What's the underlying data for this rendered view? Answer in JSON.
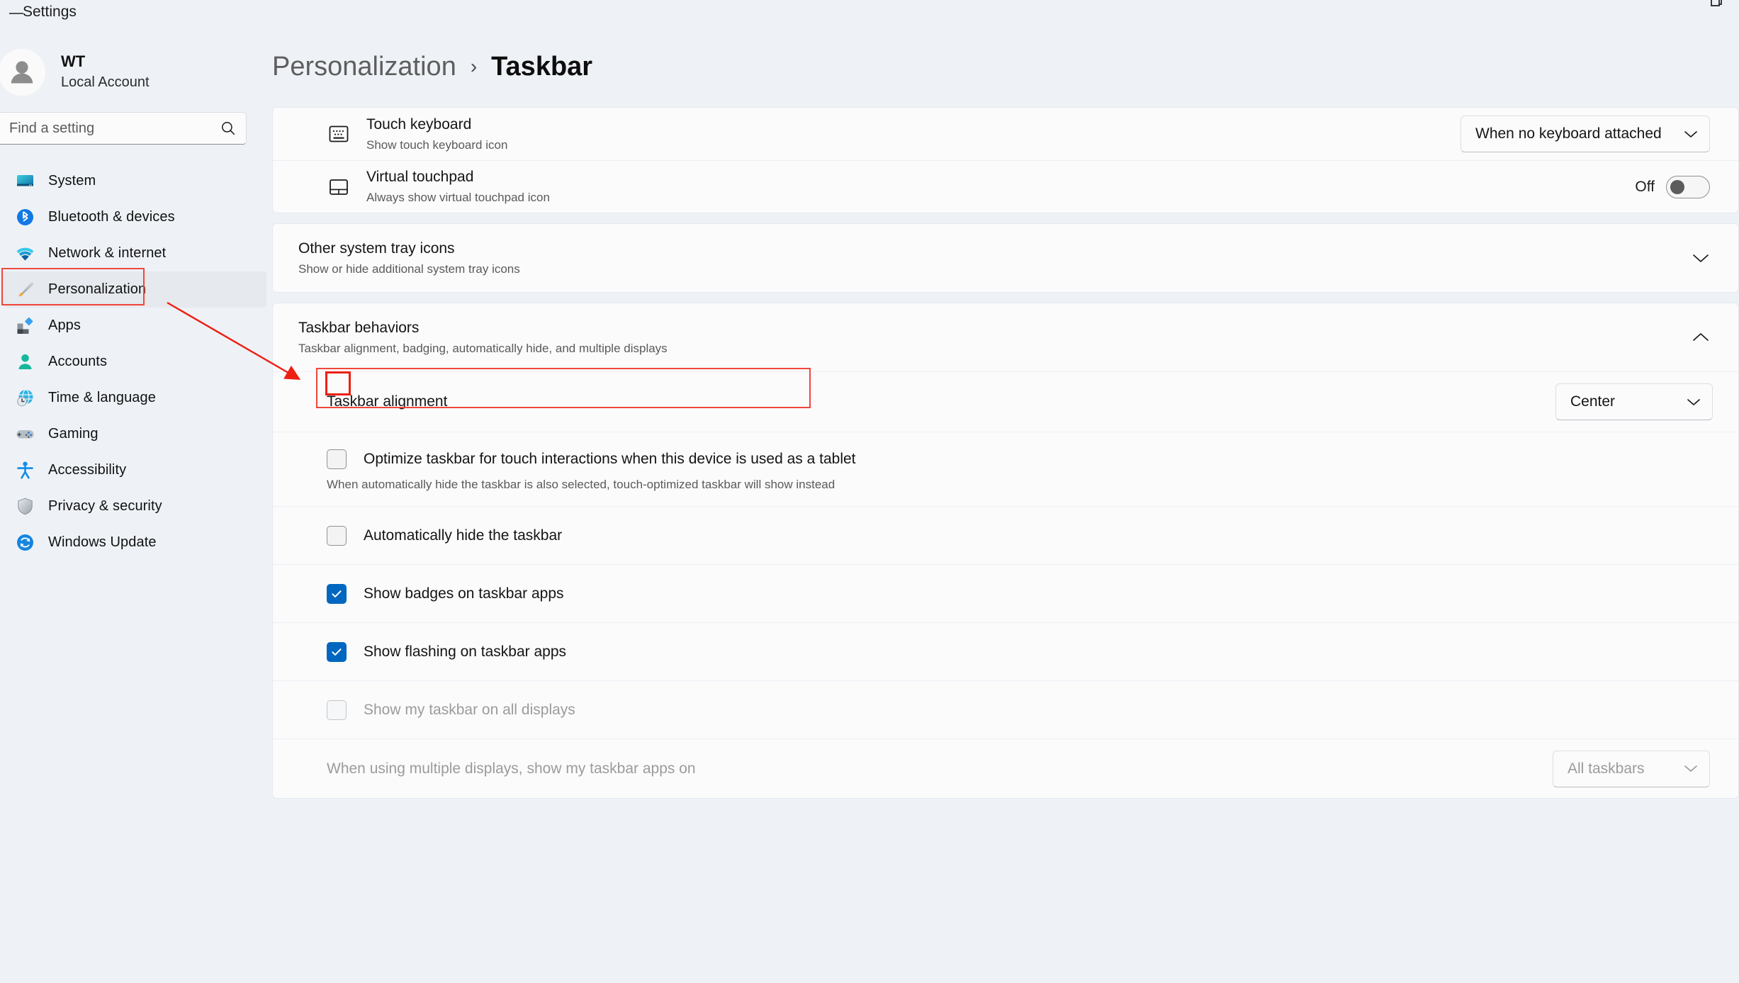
{
  "window": {
    "title": "Settings",
    "back_icon": "back-arrow-icon",
    "restore_icon": "restore-window-icon"
  },
  "sidebar": {
    "account": {
      "name": "WT",
      "type": "Local Account",
      "avatar_icon": "user-avatar-icon"
    },
    "search": {
      "placeholder": "Find a setting",
      "icon": "search-icon",
      "value": ""
    },
    "items": [
      {
        "label": "System",
        "icon": "monitor-icon",
        "active": false
      },
      {
        "label": "Bluetooth & devices",
        "icon": "bluetooth-icon",
        "active": false
      },
      {
        "label": "Network & internet",
        "icon": "wifi-icon",
        "active": false
      },
      {
        "label": "Personalization",
        "icon": "paintbrush-icon",
        "active": true
      },
      {
        "label": "Apps",
        "icon": "apps-icon",
        "active": false
      },
      {
        "label": "Accounts",
        "icon": "person-icon",
        "active": false
      },
      {
        "label": "Time & language",
        "icon": "globe-clock-icon",
        "active": false
      },
      {
        "label": "Gaming",
        "icon": "gamepad-icon",
        "active": false
      },
      {
        "label": "Accessibility",
        "icon": "accessibility-icon",
        "active": false
      },
      {
        "label": "Privacy & security",
        "icon": "shield-icon",
        "active": false
      },
      {
        "label": "Windows Update",
        "icon": "update-refresh-icon",
        "active": false
      }
    ]
  },
  "breadcrumb": {
    "parent": "Personalization",
    "separator": "›",
    "current": "Taskbar"
  },
  "main": {
    "touch_keyboard": {
      "title": "Touch keyboard",
      "subtitle": "Show touch keyboard icon",
      "icon": "touch-keyboard-icon",
      "dropdown_value": "When no keyboard attached",
      "chevron": "chevron-down-icon"
    },
    "virtual_touchpad": {
      "title": "Virtual touchpad",
      "subtitle": "Always show virtual touchpad icon",
      "icon": "touchpad-icon",
      "toggle_state": "Off"
    },
    "other_tray_icons": {
      "title": "Other system tray icons",
      "subtitle": "Show or hide additional system tray icons",
      "chevron": "chevron-down-icon",
      "expanded": false
    },
    "taskbar_behaviors": {
      "title": "Taskbar behaviors",
      "subtitle": "Taskbar alignment, badging, automatically hide, and multiple displays",
      "chevron": "chevron-up-icon",
      "expanded": true,
      "alignment": {
        "label": "Taskbar alignment",
        "value": "Center",
        "chevron": "chevron-down-icon"
      },
      "checkboxes": [
        {
          "label": "Optimize taskbar for touch interactions when this device is used as a tablet",
          "sub": "When automatically hide the taskbar is also selected, touch-optimized taskbar will show instead",
          "checked": false,
          "disabled": false,
          "highlighted": true
        },
        {
          "label": "Automatically hide the taskbar",
          "sub": "",
          "checked": false,
          "disabled": false,
          "highlighted": false
        },
        {
          "label": "Show badges on taskbar apps",
          "sub": "",
          "checked": true,
          "disabled": false,
          "highlighted": false
        },
        {
          "label": "Show flashing on taskbar apps",
          "sub": "",
          "checked": true,
          "disabled": false,
          "highlighted": false
        },
        {
          "label": "Show my taskbar on all displays",
          "sub": "",
          "checked": false,
          "disabled": true,
          "highlighted": false
        }
      ],
      "multi_display": {
        "label": "When using multiple displays, show my taskbar apps on",
        "value": "All taskbars",
        "chevron": "chevron-down-icon"
      }
    }
  },
  "annotations": {
    "accent_color": "#f0463c",
    "arrow_color": "#ee1f12"
  }
}
